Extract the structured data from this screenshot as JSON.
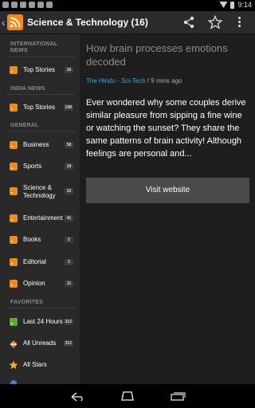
{
  "status_bar": {
    "time": "9:14"
  },
  "action_bar": {
    "title": "Science & Technology (16)",
    "icons": [
      "back-chevron-icon",
      "rss-icon",
      "share-icon",
      "star-icon",
      "more-vert-icon"
    ]
  },
  "sidebar": {
    "sections": [
      {
        "header": "INTERNATIONAL NEWS",
        "items": [
          {
            "label": "Top Stories",
            "count": "16"
          }
        ]
      },
      {
        "header": "INDIA NEWS",
        "items": [
          {
            "label": "Top Stories",
            "count": "148"
          }
        ]
      },
      {
        "header": "GENERAL",
        "items": [
          {
            "label": "Business",
            "count": "58"
          },
          {
            "label": "Sports",
            "count": "19"
          },
          {
            "label": "Science & Technology",
            "count": "15"
          },
          {
            "label": "Entertainment",
            "count": "41"
          },
          {
            "label": "Books",
            "count": "2"
          },
          {
            "label": "Editorial",
            "count": "2"
          },
          {
            "label": "Opinion",
            "count": "11"
          }
        ]
      },
      {
        "header": "FAVORITES",
        "items": [
          {
            "label": "Last 24 Hours",
            "count": "312"
          },
          {
            "label": "All Unreads",
            "count": "312"
          },
          {
            "label": "All Stars",
            "count": ""
          }
        ]
      }
    ]
  },
  "article": {
    "title": "How brain processes emotions decoded",
    "source": "The Hindu - Sci-Tech",
    "age": " / 9 mins ago",
    "body": "Ever wondered why some couples derive similar pleasure from sipping a fine wine or watching the sunset? They share the same patterns of brain activity! Although feelings are personal and...",
    "visit_label": "Visit website"
  },
  "colors": {
    "accent": "#f08a1c",
    "link": "#45a5d9",
    "favorite_green": "#5daa32",
    "star": "#f2b21a"
  }
}
